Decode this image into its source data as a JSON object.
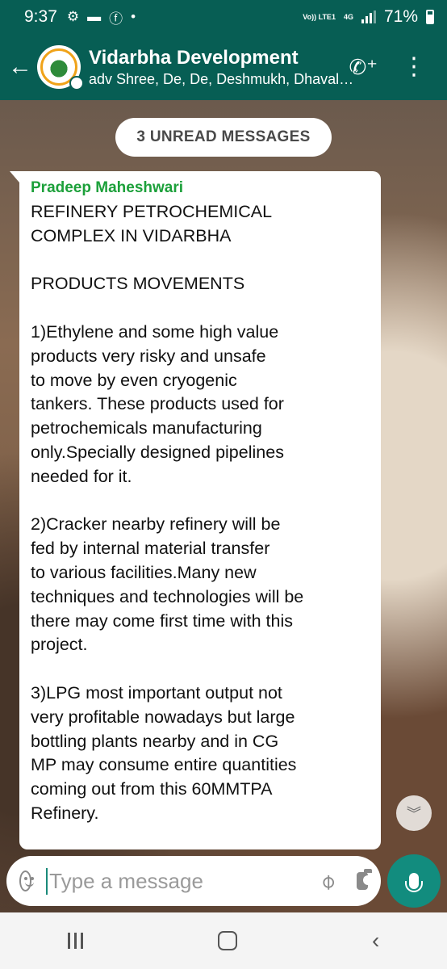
{
  "status_bar": {
    "time": "9:37",
    "network": "Vo)) LTE1",
    "network_type": "4G",
    "battery": "71%"
  },
  "header": {
    "group_name": "Vidarbha Development",
    "participants": "adv Shree, De, De, Deshmukh, Dhaval,..."
  },
  "chat": {
    "unread_banner": "3 UNREAD MESSAGES",
    "message": {
      "sender": "Pradeep Maheshwari",
      "text": "REFINERY PETROCHEMICAL\nCOMPLEX IN VIDARBHA\n\nPRODUCTS MOVEMENTS\n\n1)Ethylene and some high value\nproducts very risky and unsafe\nto move by even cryogenic\ntankers. These products used for\npetrochemicals  manufacturing\nonly.Specially designed pipelines\nneeded for it.\n\n2)Cracker nearby refinery will be\nfed by internal material transfer\nto various facilities.Many new\ntechniques and technologies will be\nthere  may come first time with this\nproject.\n\n3)LPG most important output not\nvery profitable nowadays but large\nbottling plants nearby and in CG\nMP may consume entire quantities\ncoming out from this 60MMTPA\nRefinery."
    }
  },
  "input": {
    "placeholder": "Type a message"
  },
  "colors": {
    "header": "#075e54",
    "accent": "#128c7e",
    "sender_name": "#1ca03a"
  },
  "icons": [
    "back-arrow-icon",
    "group-avatar",
    "add-call-icon",
    "more-options-icon",
    "scroll-down-icon",
    "emoji-icon",
    "attach-icon",
    "camera-icon",
    "mic-icon"
  ]
}
